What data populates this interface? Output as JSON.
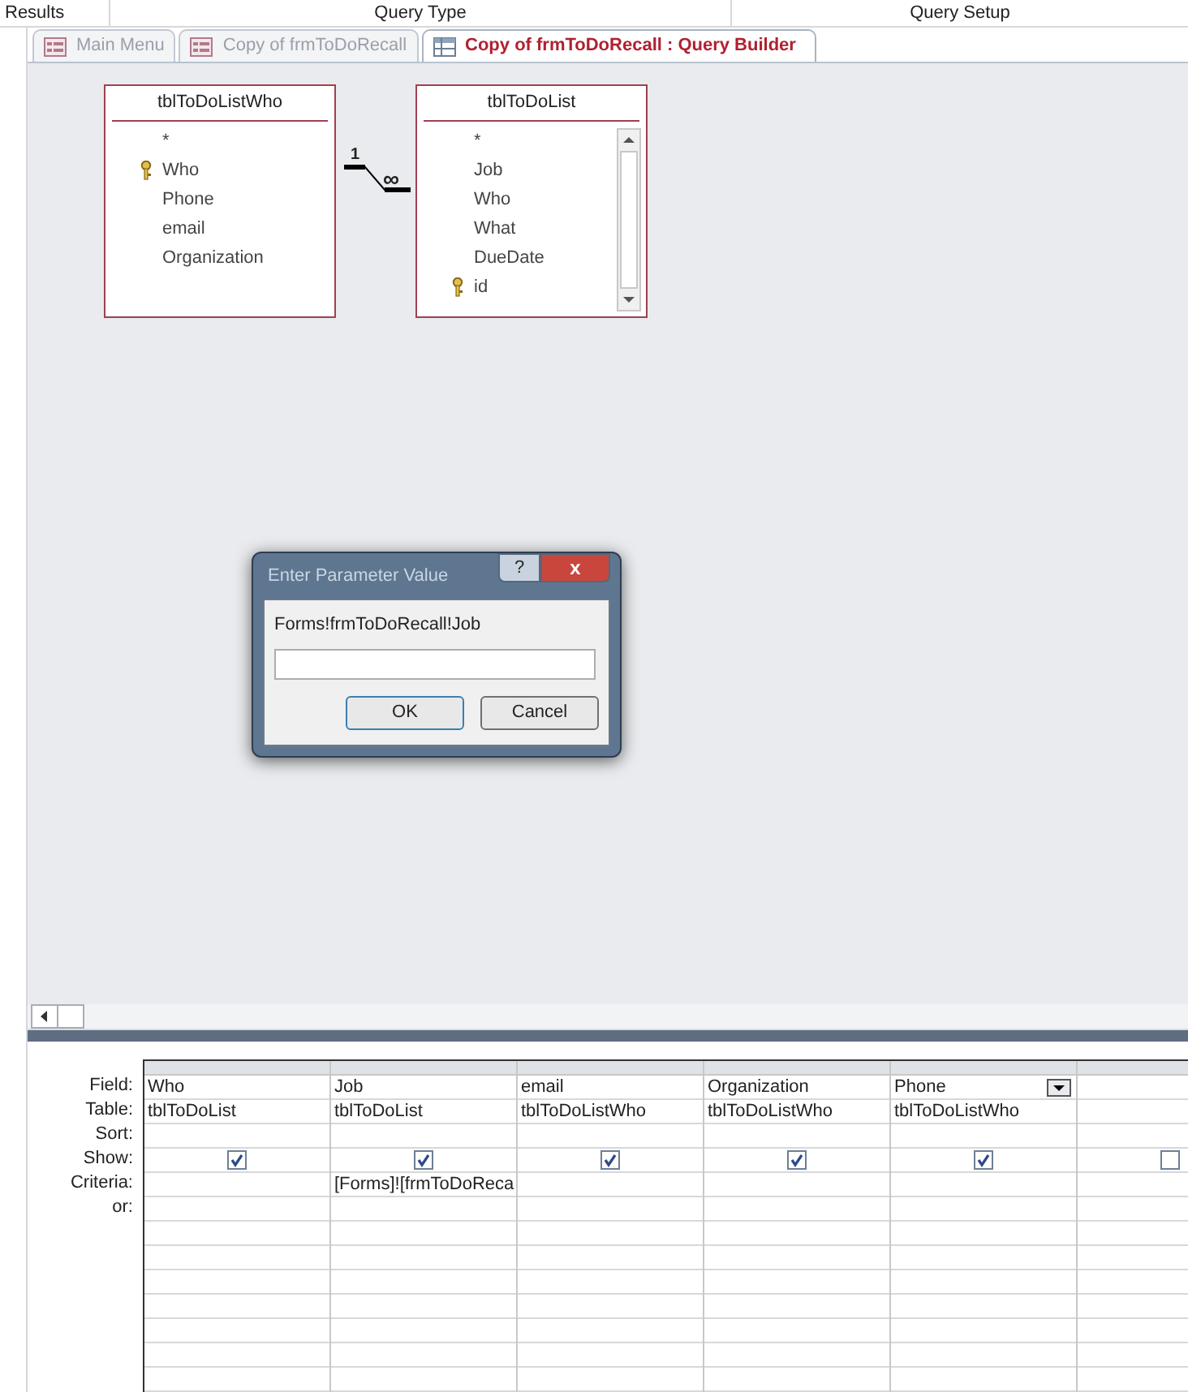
{
  "ribbon_groups": [
    "Results",
    "Query Type",
    "Query Setup"
  ],
  "tabs": [
    {
      "label": "Main Menu",
      "kind": "form",
      "selected": false
    },
    {
      "label": "Copy of frmToDoRecall",
      "kind": "form",
      "selected": false
    },
    {
      "label": "Copy of frmToDoRecall : Query Builder",
      "kind": "query",
      "selected": true
    }
  ],
  "tables": [
    {
      "name": "tblToDoListWho",
      "scrollbar": false,
      "fields": [
        {
          "name": "*",
          "primary_key": false
        },
        {
          "name": "Who",
          "primary_key": true
        },
        {
          "name": "Phone",
          "primary_key": false
        },
        {
          "name": "email",
          "primary_key": false
        },
        {
          "name": "Organization",
          "primary_key": false
        }
      ]
    },
    {
      "name": "tblToDoList",
      "scrollbar": true,
      "fields": [
        {
          "name": "*",
          "primary_key": false
        },
        {
          "name": "Job",
          "primary_key": false
        },
        {
          "name": "Who",
          "primary_key": false
        },
        {
          "name": "What",
          "primary_key": false
        },
        {
          "name": "DueDate",
          "primary_key": false
        },
        {
          "name": "id",
          "primary_key": true
        }
      ]
    }
  ],
  "relationship": {
    "one": "1",
    "many": "∞"
  },
  "dialog": {
    "title": "Enter Parameter Value",
    "help": "?",
    "close": "x",
    "prompt": "Forms!frmToDoRecall!Job",
    "buttons": [
      "OK",
      "Cancel"
    ]
  },
  "grid": {
    "row_labels": [
      "Field:",
      "Table:",
      "Sort:",
      "Show:",
      "Criteria:",
      "or:"
    ],
    "columns": [
      {
        "field": "Who",
        "table": "tblToDoList",
        "show": true,
        "dropdown": false
      },
      {
        "field": "Job",
        "table": "tblToDoList",
        "show": true,
        "criteria": "[Forms]![frmToDoReca",
        "dropdown": false
      },
      {
        "field": "email",
        "table": "tblToDoListWho",
        "show": true,
        "dropdown": false
      },
      {
        "field": "Organization",
        "table": "tblToDoListWho",
        "show": true,
        "dropdown": false
      },
      {
        "field": "Phone",
        "table": "tblToDoListWho",
        "show": true,
        "dropdown": true
      },
      {
        "show": false
      }
    ]
  }
}
